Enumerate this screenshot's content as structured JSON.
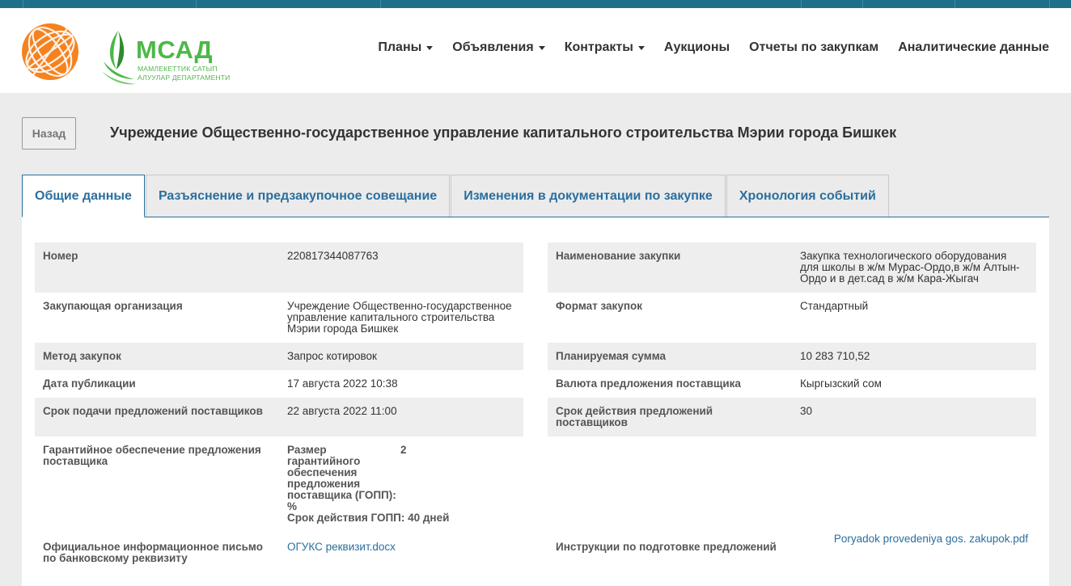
{
  "brand": {
    "title": "МСАД",
    "subtitle_line1": "МАМЛЕКЕТТИК САТЫП",
    "subtitle_line2": "АЛУУЛАР ДЕПАРТАМЕНТИ",
    "colors": {
      "green": "#4db848",
      "orange": "#f58220",
      "nav_bar": "#1f6f8b",
      "accent": "#2a6f9e"
    }
  },
  "nav": [
    {
      "label": "Планы",
      "dropdown": true
    },
    {
      "label": "Объявления",
      "dropdown": true
    },
    {
      "label": "Контракты",
      "dropdown": true
    },
    {
      "label": "Аукционы",
      "dropdown": false
    },
    {
      "label": "Отчеты по закупкам",
      "dropdown": false
    },
    {
      "label": "Аналитические данные",
      "dropdown": false
    }
  ],
  "back_label": "Назад",
  "page_title": "Учреждение Общественно-государственное управление капитального строительства Мэрии города Бишкек",
  "tabs": [
    {
      "label": "Общие данные",
      "active": true
    },
    {
      "label": "Разъяснение и предзакупочное совещание",
      "active": false
    },
    {
      "label": "Изменения в документации по закупке",
      "active": false
    },
    {
      "label": "Хронология событий",
      "active": false
    }
  ],
  "details": {
    "left": [
      {
        "label": "Номер",
        "value": "220817344087763"
      },
      {
        "label": "Закупающая организация",
        "value": "Учреждение Общественно-государственное управление капитального строительства Мэрии города Бишкек"
      },
      {
        "label": "Метод закупок",
        "value": "Запрос котировок"
      },
      {
        "label": "Дата публикации",
        "value": "17 августа 2022 10:38"
      },
      {
        "label": "Срок подачи предложений поставщиков",
        "value": "22 августа 2022 11:00"
      },
      {
        "label": "Гарантийное обеспечение предложения поставщика",
        "guar_key": "Размер гарантийного обеспечения предложения поставщика (ГОПП): %",
        "guar_val": "2",
        "guar_term": "Срок действия ГОПП: 40 дней"
      },
      {
        "label": "Официальное информационное письмо по банковскому реквизиту",
        "value": "ОГУКС реквизит.docx"
      }
    ],
    "right": [
      {
        "label": "Наименование закупки",
        "value": "Закупка технологического оборудования для школы в ж/м Мурас-Ордо,в ж/м Алтын-Ордо и в дет.сад в ж/м Кара-Жыгач"
      },
      {
        "label": "Формат закупок",
        "value": "Стандартный"
      },
      {
        "label": "Планируемая сумма",
        "value": "10 283 710,52"
      },
      {
        "label": "Валюта предложения поставщика",
        "value": "Кыргызский сом"
      },
      {
        "label": "Срок действия предложений поставщиков",
        "value": "30"
      },
      {
        "label": "Инструкции по подготовке предложений",
        "value": "Poryadok provedeniya gos. zakupok.pdf"
      }
    ]
  }
}
